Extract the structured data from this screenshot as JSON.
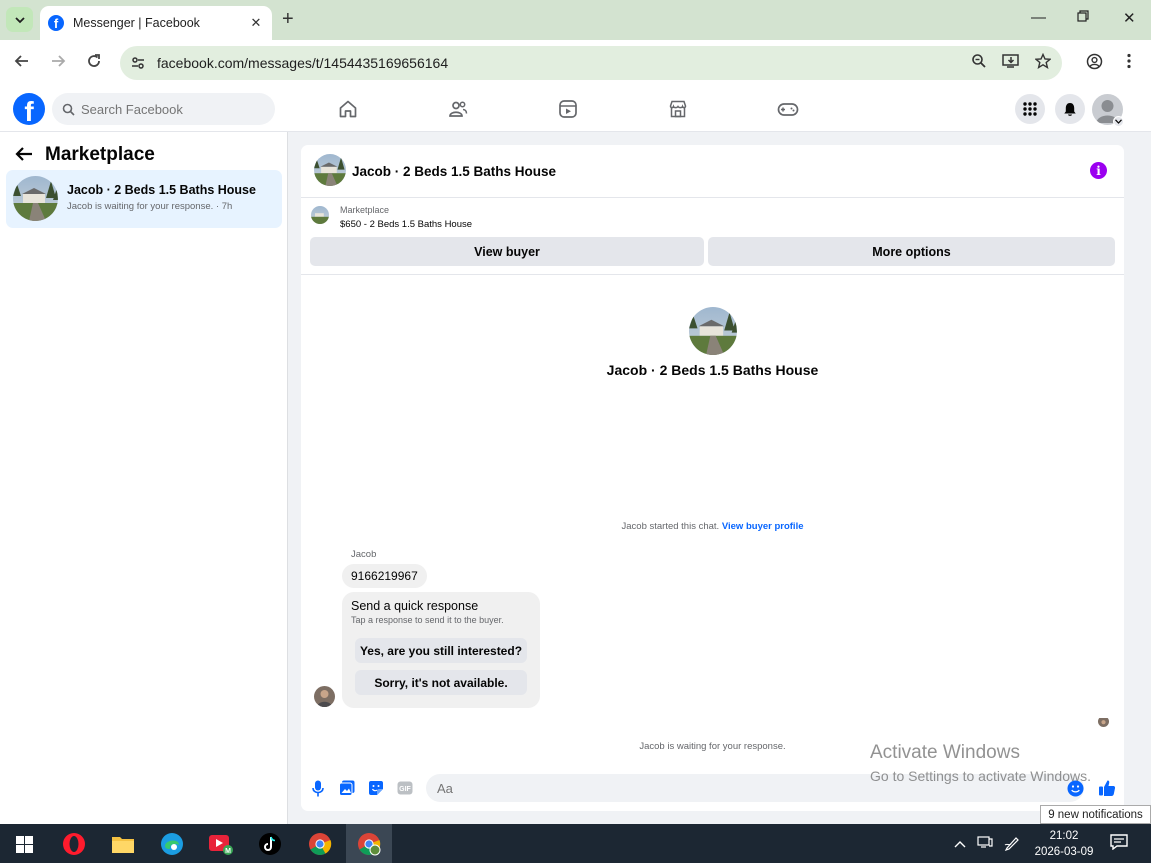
{
  "browser": {
    "tab_title": "Messenger | Facebook",
    "url": "facebook.com/messages/t/1454435169656164"
  },
  "fb": {
    "search_placeholder": "Search Facebook"
  },
  "sidebar": {
    "title": "Marketplace",
    "conversation": {
      "name": "Jacob · 2 Beds 1.5 Baths House",
      "preview": "Jacob is waiting for your response. · 7h"
    }
  },
  "chat": {
    "header_name": "Jacob · 2 Beds 1.5 Baths House",
    "marketplace_label": "Marketplace",
    "listing": "$650 - 2 Beds 1.5 Baths House",
    "view_buyer": "View buyer",
    "more_options": "More options",
    "intro_name": "Jacob · 2 Beds 1.5 Baths House",
    "started_text": "Jacob started this chat.",
    "view_profile": "View buyer profile",
    "sender": "Jacob",
    "message": "9166219967",
    "quick_title": "Send a quick response",
    "quick_sub": "Tap a response to send it to the buyer.",
    "quick_1": "Yes, are you still interested?",
    "quick_2": "Sorry, it's not available.",
    "waiting": "Jacob is waiting for your response.",
    "composer_placeholder": "Aa"
  },
  "overlay": {
    "activate_title": "Activate Windows",
    "activate_sub": "Go to Settings to activate Windows.",
    "notifications": "9 new notifications"
  },
  "taskbar": {
    "time": "21:02",
    "date": "2026-03-09"
  },
  "colors": {
    "fb_blue": "#0866ff",
    "info_purple": "#9b00f0",
    "selected_bg": "#e7f3ff"
  }
}
